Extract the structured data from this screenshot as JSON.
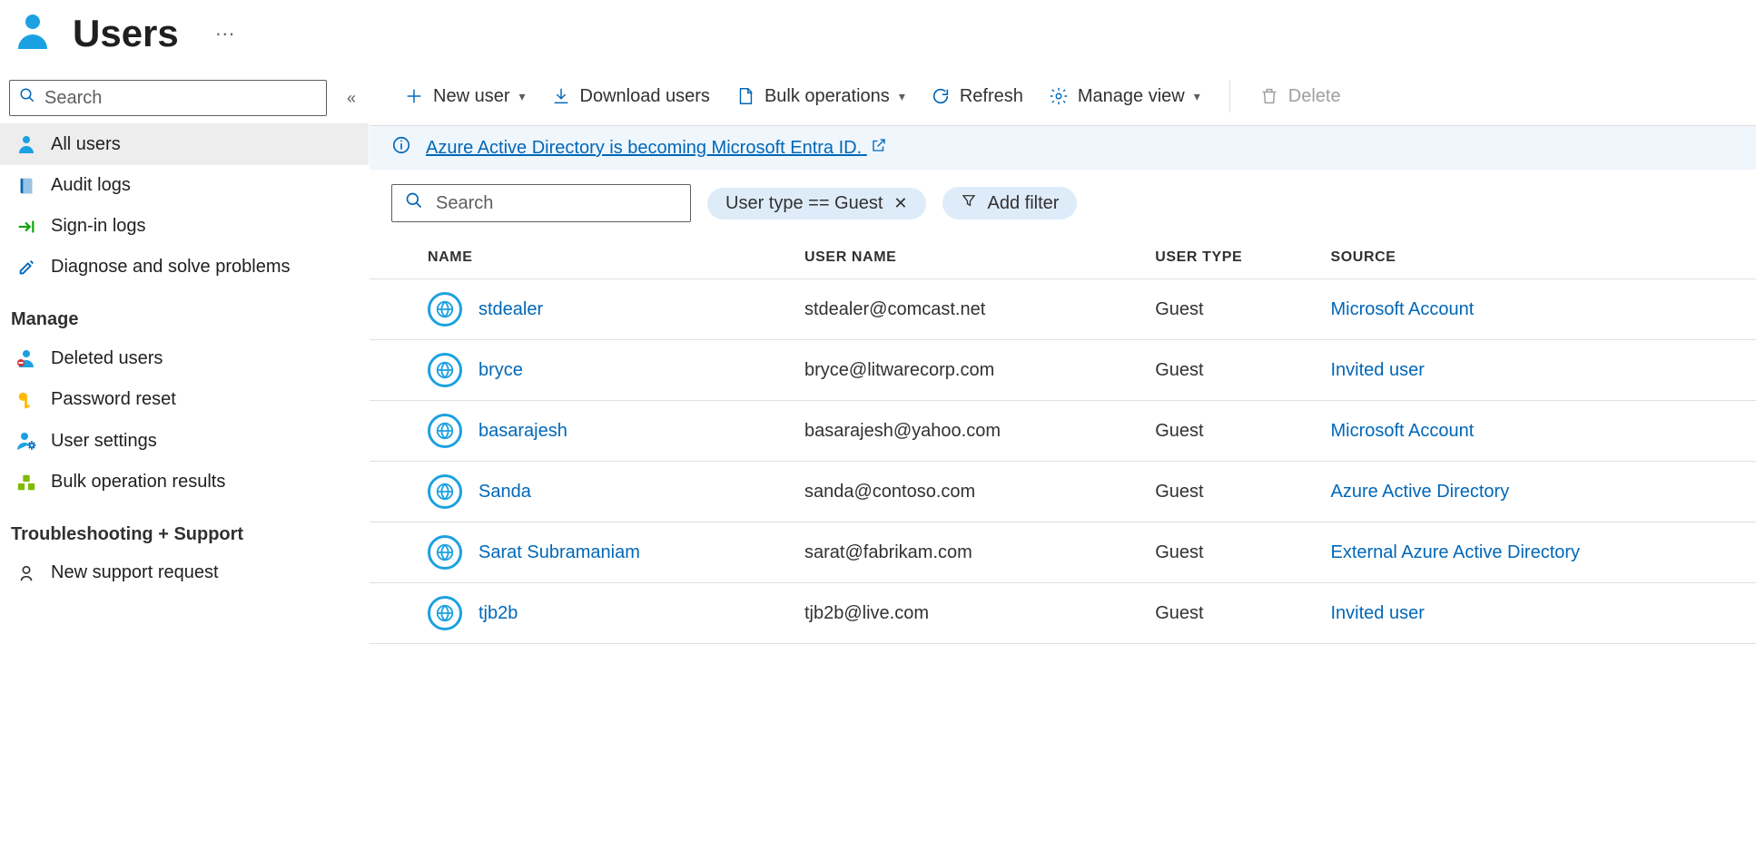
{
  "header": {
    "title": "Users"
  },
  "sidebar": {
    "search_placeholder": "Search",
    "items": [
      {
        "icon": "user",
        "label": "All users",
        "active": true
      },
      {
        "icon": "book",
        "label": "Audit logs"
      },
      {
        "icon": "signin",
        "label": "Sign-in logs"
      },
      {
        "icon": "wrench",
        "label": "Diagnose and solve problems"
      }
    ],
    "groups": [
      {
        "label": "Manage",
        "items": [
          {
            "icon": "user-del",
            "label": "Deleted users"
          },
          {
            "icon": "key",
            "label": "Password reset"
          },
          {
            "icon": "user-gear",
            "label": "User settings"
          },
          {
            "icon": "cubes",
            "label": "Bulk operation results"
          }
        ]
      },
      {
        "label": "Troubleshooting + Support",
        "items": [
          {
            "icon": "support",
            "label": "New support request"
          }
        ]
      }
    ]
  },
  "toolbar": {
    "new_user": "New user",
    "download": "Download users",
    "bulk_ops": "Bulk operations",
    "refresh": "Refresh",
    "manage_view": "Manage view",
    "delete": "Delete"
  },
  "banner": {
    "text": "Azure Active Directory is becoming Microsoft Entra ID."
  },
  "filters": {
    "search_placeholder": "Search",
    "pill_filter": "User type == Guest",
    "add_filter": "Add filter"
  },
  "table": {
    "columns": [
      "NAME",
      "USER NAME",
      "USER TYPE",
      "SOURCE"
    ],
    "rows": [
      {
        "name": "stdealer",
        "username": "stdealer@comcast.net",
        "usertype": "Guest",
        "source": "Microsoft Account"
      },
      {
        "name": "bryce",
        "username": "bryce@litwarecorp.com",
        "usertype": "Guest",
        "source": "Invited user"
      },
      {
        "name": "basarajesh",
        "username": "basarajesh@yahoo.com",
        "usertype": "Guest",
        "source": "Microsoft Account"
      },
      {
        "name": "Sanda",
        "username": "sanda@contoso.com",
        "usertype": "Guest",
        "source": "Azure Active Directory"
      },
      {
        "name": "Sarat Subramaniam",
        "username": "sarat@fabrikam.com",
        "usertype": "Guest",
        "source": "External Azure Active Directory"
      },
      {
        "name": "tjb2b",
        "username": "tjb2b@live.com",
        "usertype": "Guest",
        "source": "Invited user"
      }
    ]
  }
}
